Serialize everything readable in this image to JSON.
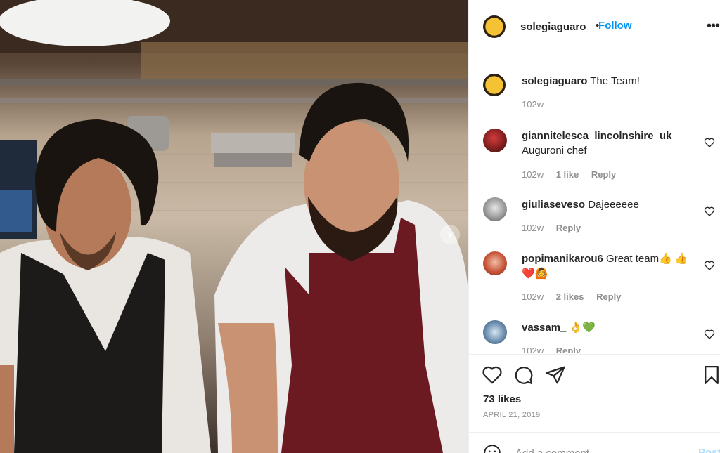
{
  "post": {
    "username": "solegiaguaro",
    "separator": "•",
    "follow_label": "Follow",
    "more_icon": "more-horizontal-icon",
    "caption_user": "solegiaguaro",
    "caption_text": "The Team!",
    "caption_time": "102w"
  },
  "comments": [
    {
      "user": "giannitelesca_lincolnshire_uk",
      "text": "Auguroni chef",
      "time": "102w",
      "likes": "1 like",
      "reply": "Reply"
    },
    {
      "user": "giuliaseveso",
      "text": "Dajeeeeee",
      "time": "102w",
      "likes": "",
      "reply": "Reply"
    },
    {
      "user": "popimanikarou6",
      "text": "Great team👍 👍❤️🙆",
      "time": "102w",
      "likes": "2 likes",
      "reply": "Reply"
    },
    {
      "user": "vassam_",
      "text": "👌💚",
      "time": "102w",
      "likes": "",
      "reply": "Reply"
    }
  ],
  "actions": {
    "icons": [
      "heart-icon",
      "comment-icon",
      "share-icon",
      "bookmark-icon"
    ],
    "likes": "73 likes",
    "date": "APRIL 21, 2019",
    "comment_placeholder": "Add a comment...",
    "post_label": "Post"
  },
  "colors": {
    "link": "#0095f6",
    "muted": "#8e8e8e",
    "text": "#262626",
    "post_disabled": "#b2dffc"
  }
}
